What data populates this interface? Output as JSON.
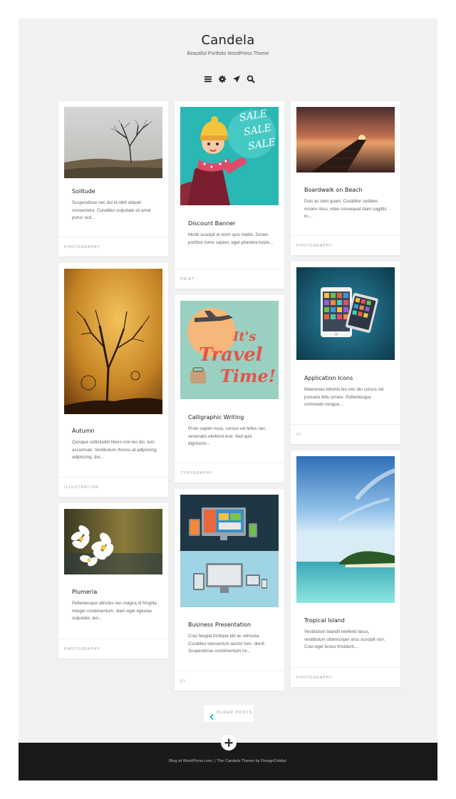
{
  "site": {
    "title": "Candela",
    "description": "Beautiful Portfolio WordPress Theme"
  },
  "header_icons": [
    "menu-icon",
    "gear-icon",
    "send-icon",
    "search-icon"
  ],
  "posts": [
    {
      "title": "Solitude",
      "excerpt": "Suspendisse nec dui id nibh aliquet consectetur. Curabitur vulputate sit amet purus sed...",
      "category": "PHOTOGRAPHY"
    },
    {
      "title": "Autumn",
      "excerpt": "Quisque sollicitudin libero non leo dic- tum accumsan. Vestibulum rhoncu at adipiscing adipiscing, dui...",
      "category": "ILLUSTRATION"
    },
    {
      "title": "Plumeria",
      "excerpt": "Pellentesque ultricies nec magna id fringilla. Integer condimentum, diam eget egestas vulputate, leo...",
      "category": "PHOTOGRAPHY"
    },
    {
      "title": "Discount Banner",
      "excerpt": "Morbi suscipit et enim quis mattis. Donec porttitor tortor sapien, eget pharetra turpis...",
      "category": "PRINT",
      "image_text": [
        "SALE",
        "SALE",
        "SALE"
      ]
    },
    {
      "title": "Calligraphic Writing",
      "excerpt": "Proin sapien risus, cursus vel tellus nec, venenatis eleifend erat. Sed quis dignissim...",
      "category": "TYPOGRAPHY",
      "image_text": [
        "It's",
        "Travel",
        "Time!"
      ]
    },
    {
      "title": "Business Presentation",
      "excerpt": "Cras feugiat tristique elit ac vehicula. Curabitur elementum auctor hen- drerit. Suspendisse condimentum mi...",
      "category": "UI"
    },
    {
      "title": "Boardwalk on Beach",
      "excerpt": "Duis ac sem quam. Curabitur sodales ornare risus, vitae consequat diam sagittis in....",
      "category": "PHOTOGRAPHY"
    },
    {
      "title": "Application Icons",
      "excerpt": "Maecenas lobortis leo nec dui cursus vel posuere felis ornare. Pellentesque commodo congue...",
      "category": "UI"
    },
    {
      "title": "Tropical Island",
      "excerpt": "Vestibulum blandit eleifend lacus, vestibulum ullamcorper arcu suscipit non. Cras eget lectus tincidunt,...",
      "category": "PHOTOGRAPHY"
    }
  ],
  "pagination": {
    "older_label": "OLDER POSTS"
  },
  "footer": {
    "credit_1": "Blog at WordPress.com.",
    "divider": " | ",
    "credit_2": "The Candela Theme by DesignOrbital."
  },
  "colors": {
    "accent": "#1ab0c8",
    "page_bg": "#f1f1f1",
    "footer_bg": "#1a1a1a"
  }
}
